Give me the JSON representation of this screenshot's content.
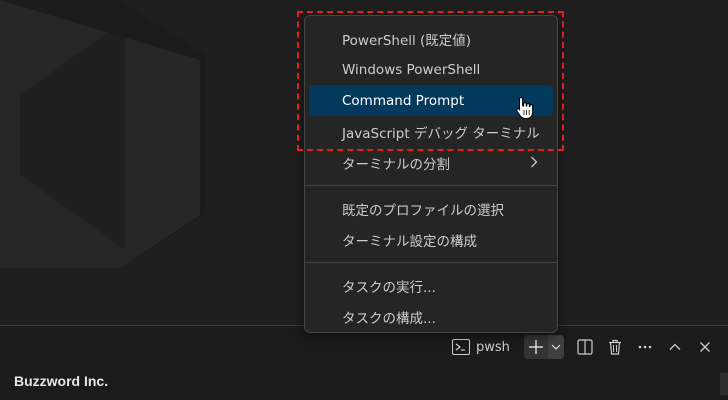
{
  "menu": {
    "items": [
      {
        "label": "PowerShell (既定値)"
      },
      {
        "label": "Windows PowerShell"
      },
      {
        "label": "Command Prompt",
        "selected": true
      },
      {
        "label": "JavaScript デバッグ ターミナル"
      },
      {
        "label": "ターミナルの分割",
        "submenu": true
      }
    ],
    "group2": [
      {
        "label": "既定のプロファイルの選択"
      },
      {
        "label": "ターミナル設定の構成"
      }
    ],
    "group3": [
      {
        "label": "タスクの実行..."
      },
      {
        "label": "タスクの構成..."
      }
    ]
  },
  "toolbar": {
    "terminal_name": "pwsh",
    "icons": [
      "terminal-icon",
      "plus-icon",
      "chevron-down-icon",
      "split-icon",
      "trash-icon",
      "ellipsis-icon",
      "chevron-up-icon",
      "close-icon"
    ]
  },
  "company": "Buzzword Inc.",
  "colors": {
    "selected_bg": "#04395e",
    "highlight_border": "#e21e1e",
    "menu_bg": "#252526"
  }
}
